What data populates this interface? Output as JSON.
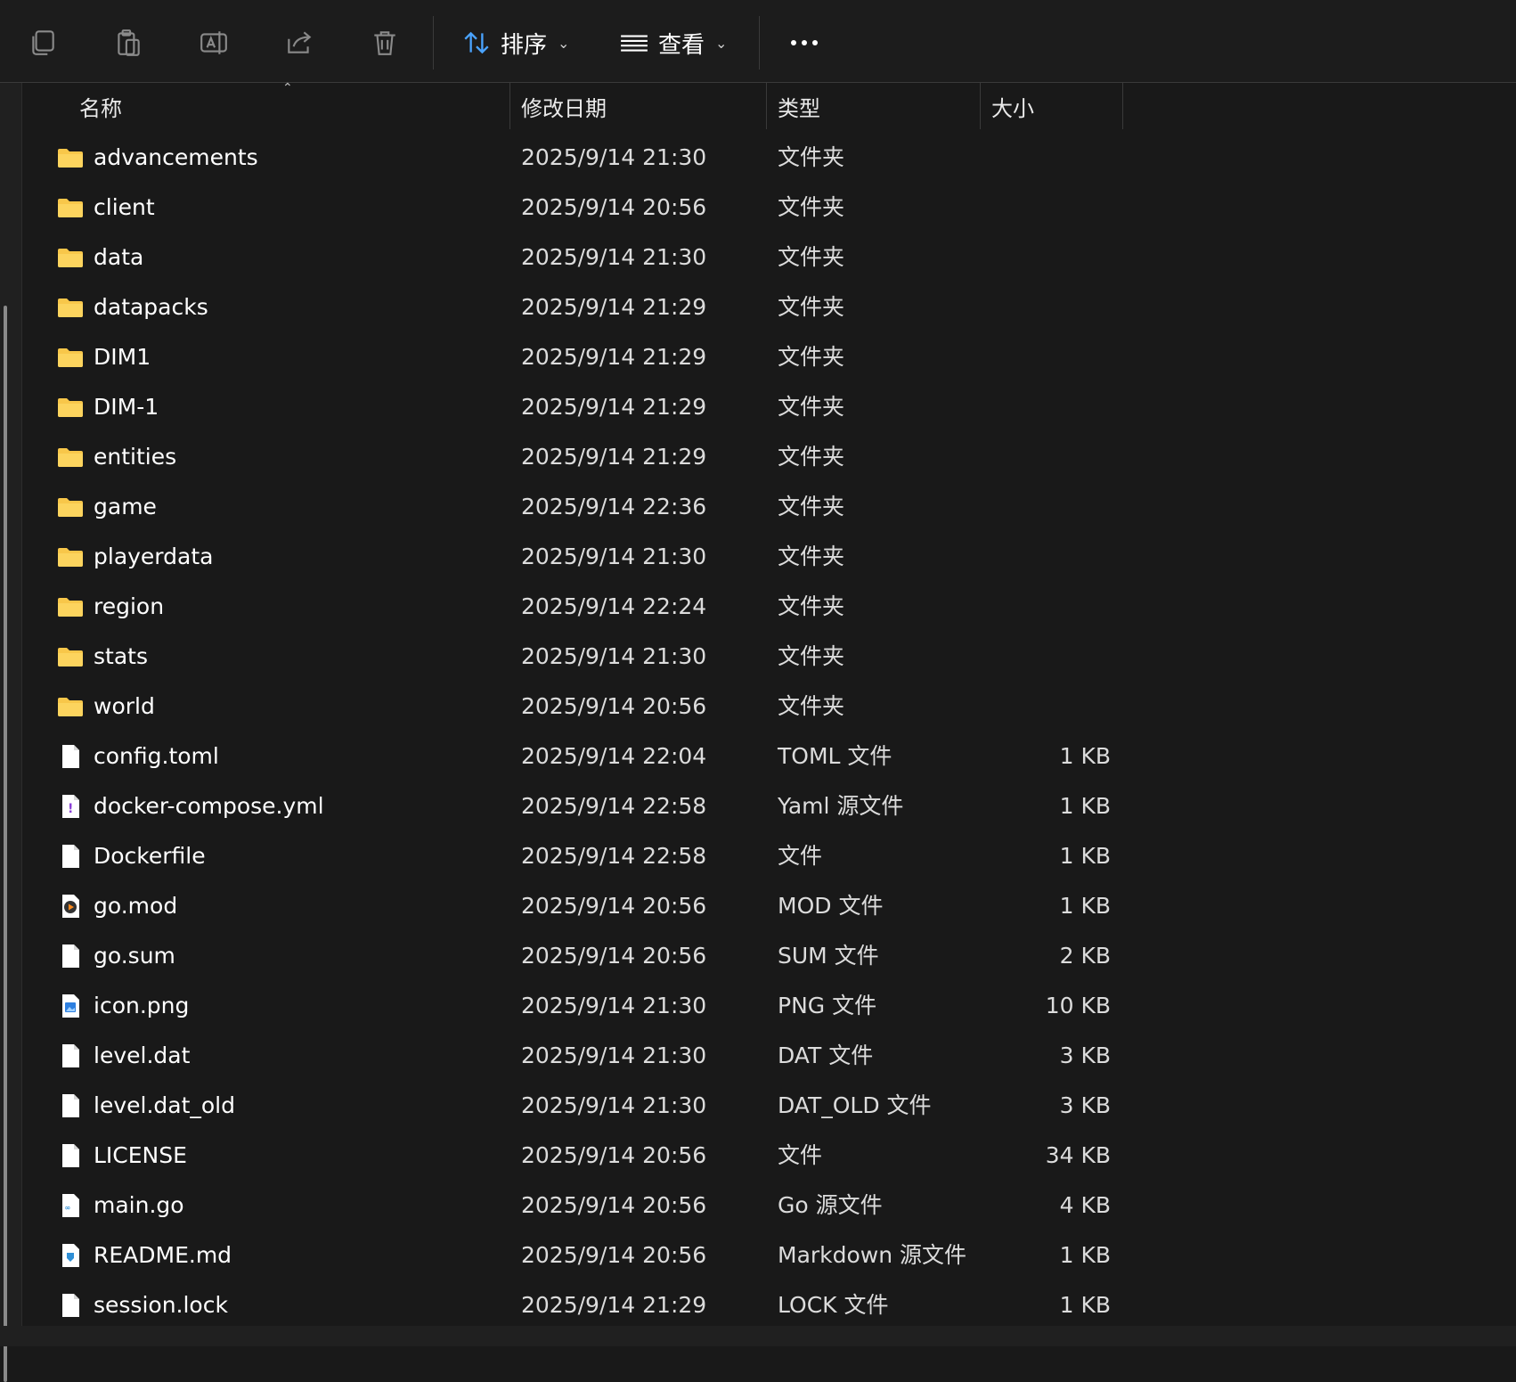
{
  "toolbar": {
    "sort_label": "排序",
    "view_label": "查看",
    "icons": [
      "copy-icon",
      "paste-icon",
      "rename-icon",
      "share-icon",
      "delete-icon"
    ]
  },
  "columns": {
    "name": "名称",
    "date": "修改日期",
    "type": "类型",
    "size": "大小"
  },
  "files": [
    {
      "name": "advancements",
      "date": "2025/9/14 21:30",
      "type": "文件夹",
      "size": "",
      "icon": "folder"
    },
    {
      "name": "client",
      "date": "2025/9/14 20:56",
      "type": "文件夹",
      "size": "",
      "icon": "folder"
    },
    {
      "name": "data",
      "date": "2025/9/14 21:30",
      "type": "文件夹",
      "size": "",
      "icon": "folder"
    },
    {
      "name": "datapacks",
      "date": "2025/9/14 21:29",
      "type": "文件夹",
      "size": "",
      "icon": "folder"
    },
    {
      "name": "DIM1",
      "date": "2025/9/14 21:29",
      "type": "文件夹",
      "size": "",
      "icon": "folder"
    },
    {
      "name": "DIM-1",
      "date": "2025/9/14 21:29",
      "type": "文件夹",
      "size": "",
      "icon": "folder"
    },
    {
      "name": "entities",
      "date": "2025/9/14 21:29",
      "type": "文件夹",
      "size": "",
      "icon": "folder"
    },
    {
      "name": "game",
      "date": "2025/9/14 22:36",
      "type": "文件夹",
      "size": "",
      "icon": "folder"
    },
    {
      "name": "playerdata",
      "date": "2025/9/14 21:30",
      "type": "文件夹",
      "size": "",
      "icon": "folder"
    },
    {
      "name": "region",
      "date": "2025/9/14 22:24",
      "type": "文件夹",
      "size": "",
      "icon": "folder"
    },
    {
      "name": "stats",
      "date": "2025/9/14 21:30",
      "type": "文件夹",
      "size": "",
      "icon": "folder"
    },
    {
      "name": "world",
      "date": "2025/9/14 20:56",
      "type": "文件夹",
      "size": "",
      "icon": "folder"
    },
    {
      "name": "config.toml",
      "date": "2025/9/14 22:04",
      "type": "TOML 文件",
      "size": "1 KB",
      "icon": "file"
    },
    {
      "name": "docker-compose.yml",
      "date": "2025/9/14 22:58",
      "type": "Yaml 源文件",
      "size": "1 KB",
      "icon": "yaml"
    },
    {
      "name": "Dockerfile",
      "date": "2025/9/14 22:58",
      "type": "文件",
      "size": "1 KB",
      "icon": "file"
    },
    {
      "name": "go.mod",
      "date": "2025/9/14 20:56",
      "type": "MOD 文件",
      "size": "1 KB",
      "icon": "media"
    },
    {
      "name": "go.sum",
      "date": "2025/9/14 20:56",
      "type": "SUM 文件",
      "size": "2 KB",
      "icon": "file"
    },
    {
      "name": "icon.png",
      "date": "2025/9/14 21:30",
      "type": "PNG 文件",
      "size": "10 KB",
      "icon": "image"
    },
    {
      "name": "level.dat",
      "date": "2025/9/14 21:30",
      "type": "DAT 文件",
      "size": "3 KB",
      "icon": "file"
    },
    {
      "name": "level.dat_old",
      "date": "2025/9/14 21:30",
      "type": "DAT_OLD 文件",
      "size": "3 KB",
      "icon": "file"
    },
    {
      "name": "LICENSE",
      "date": "2025/9/14 20:56",
      "type": "文件",
      "size": "34 KB",
      "icon": "file"
    },
    {
      "name": "main.go",
      "date": "2025/9/14 20:56",
      "type": "Go 源文件",
      "size": "4 KB",
      "icon": "go"
    },
    {
      "name": "README.md",
      "date": "2025/9/14 20:56",
      "type": "Markdown 源文件",
      "size": "1 KB",
      "icon": "markdown"
    },
    {
      "name": "session.lock",
      "date": "2025/9/14 21:29",
      "type": "LOCK 文件",
      "size": "1 KB",
      "icon": "file"
    }
  ],
  "colors": {
    "background": "#191919",
    "folder": "#f8c74a",
    "accent": "#4aa3ff"
  }
}
